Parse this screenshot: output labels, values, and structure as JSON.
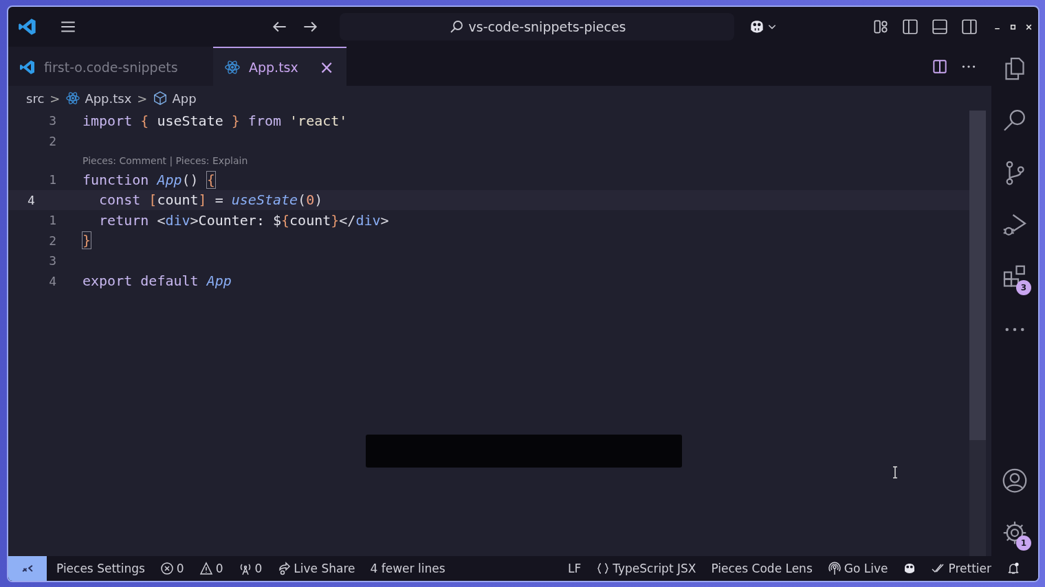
{
  "title_bar": {
    "search": "vs-code-snippets-pieces"
  },
  "tabs": [
    {
      "label": "first-o.code-snippets",
      "selected": false
    },
    {
      "label": "App.tsx",
      "selected": true,
      "close": "×"
    }
  ],
  "breadcrumbs": [
    "src",
    "App.tsx",
    "App"
  ],
  "breadcrumb_sep": ">",
  "editor": {
    "lines": [
      {
        "kind": "code",
        "number": "3",
        "current": false,
        "tokens": [
          {
            "t": "import ",
            "kind": "keyword"
          },
          {
            "t": "{ ",
            "kind": "brace"
          },
          {
            "t": "useState ",
            "kind": "ident"
          },
          {
            "t": "} ",
            "kind": "brace"
          },
          {
            "t": "from ",
            "kind": "keyword"
          },
          {
            "t": "'react'",
            "kind": "string"
          }
        ]
      },
      {
        "kind": "code",
        "number": "2",
        "current": false
      },
      {
        "kind": "lens",
        "text": "Pieces: Comment | Pieces: Explain"
      },
      {
        "kind": "code",
        "number": "1",
        "current": false,
        "tokens": [
          {
            "t": "function ",
            "kind": "keyword"
          },
          {
            "t": "App",
            "kind": "func"
          },
          {
            "t": "() ",
            "kind": "punct"
          },
          {
            "t": "{",
            "kind": "match"
          }
        ]
      },
      {
        "kind": "code",
        "number": "4",
        "current": true,
        "tokens": [
          {
            "t": "  const ",
            "kind": "keyword"
          },
          {
            "t": "[",
            "kind": "brace"
          },
          {
            "t": "count",
            "kind": "ident"
          },
          {
            "t": "] ",
            "kind": "brace"
          },
          {
            "t": "= ",
            "kind": "punct"
          },
          {
            "t": "useState",
            "kind": "func"
          },
          {
            "t": "(",
            "kind": "punct"
          },
          {
            "t": "0",
            "kind": "number"
          },
          {
            "t": ")",
            "kind": "punct"
          }
        ]
      },
      {
        "kind": "code",
        "number": "1",
        "current": false,
        "tokens": [
          {
            "t": "  return ",
            "kind": "keyword"
          },
          {
            "t": "<",
            "kind": "punct"
          },
          {
            "t": "div",
            "kind": "tag"
          },
          {
            "t": ">",
            "kind": "punct"
          },
          {
            "t": "Counter: $",
            "kind": "ident"
          },
          {
            "t": "{",
            "kind": "brace"
          },
          {
            "t": "count",
            "kind": "ident"
          },
          {
            "t": "}",
            "kind": "brace"
          },
          {
            "t": "</",
            "kind": "punct"
          },
          {
            "t": "div",
            "kind": "tag"
          },
          {
            "t": ">",
            "kind": "punct"
          }
        ]
      },
      {
        "kind": "code",
        "number": "2",
        "current": false,
        "tokens": [
          {
            "t": "}",
            "kind": "match"
          }
        ]
      },
      {
        "kind": "code",
        "number": "3",
        "current": false
      },
      {
        "kind": "code",
        "number": "4",
        "current": false,
        "tokens": [
          {
            "t": "export ",
            "kind": "keyword"
          },
          {
            "t": "default ",
            "kind": "keyword"
          },
          {
            "t": "App",
            "kind": "func"
          }
        ]
      }
    ]
  },
  "activity_bar": {
    "extensions_badge": "3",
    "settings_badge": "1"
  },
  "status_left": [
    {
      "kind": "plain",
      "text": "Pieces Settings"
    },
    {
      "kind": "error",
      "text": "0"
    },
    {
      "kind": "warning",
      "text": "0"
    },
    {
      "kind": "antenna",
      "text": "0"
    },
    {
      "kind": "share",
      "text": "Live Share"
    },
    {
      "kind": "plain",
      "text": "4 fewer lines"
    }
  ],
  "status_right": [
    {
      "kind": "plain",
      "text": "LF"
    },
    {
      "kind": "braces",
      "text": "TypeScript JSX"
    },
    {
      "kind": "plain",
      "text": "Pieces Code Lens"
    },
    {
      "kind": "broadcast",
      "text": "Go Live"
    },
    {
      "kind": "copilot"
    },
    {
      "kind": "checks",
      "text": "Prettier"
    },
    {
      "kind": "bell"
    }
  ]
}
